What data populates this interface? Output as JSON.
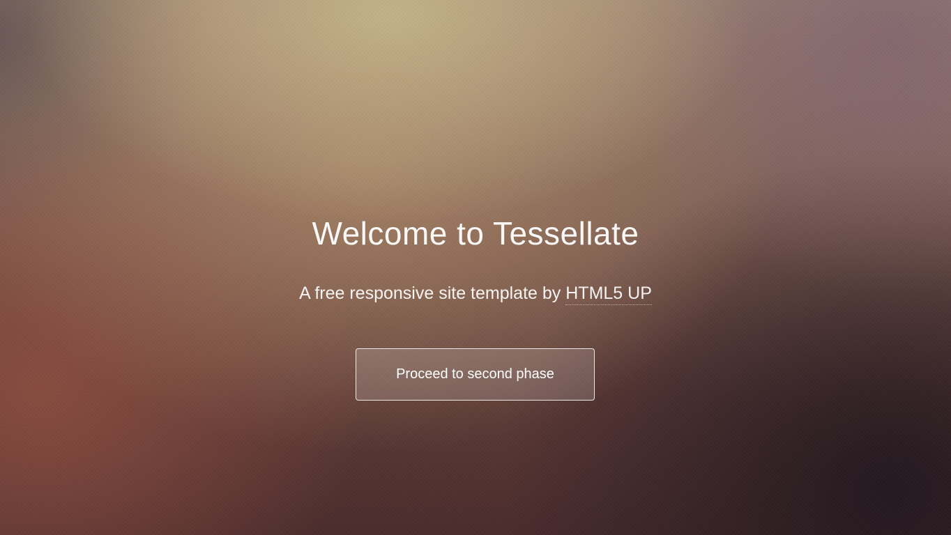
{
  "hero": {
    "title": "Welcome to Tessellate",
    "subtitle_prefix": "A free responsive site template by ",
    "subtitle_link": "HTML5 UP",
    "button_label": "Proceed to second phase"
  },
  "colors": {
    "text": "#ffffff",
    "background_top": "#c4b48a",
    "background_bottom_left": "#8c4e40",
    "background_bottom_right": "#20181e"
  }
}
